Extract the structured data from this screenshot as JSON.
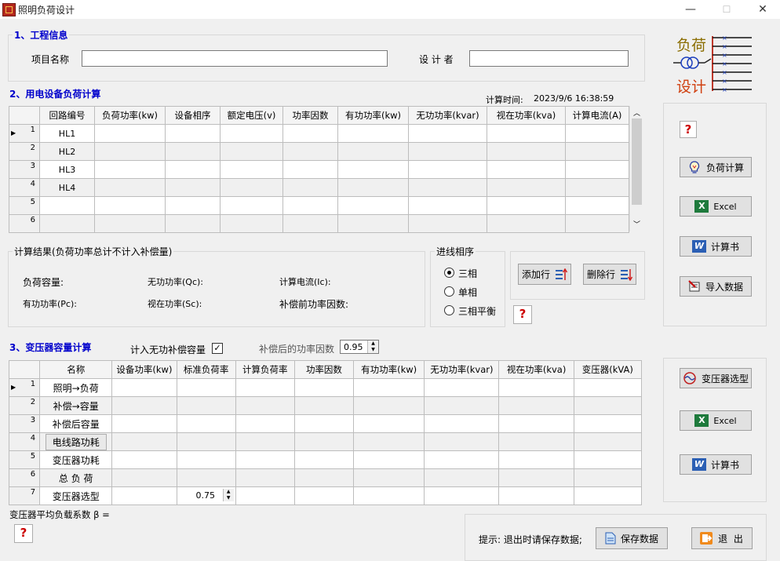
{
  "window": {
    "title": "照明负荷设计",
    "minimize": "—",
    "maximize": "☐",
    "close": "✕"
  },
  "project": {
    "section_title": "1、工程信息",
    "name_label": "项目名称",
    "name_value": "",
    "designer_label": "设 计 者",
    "designer_value": ""
  },
  "logo": {
    "top_text": "负荷",
    "bottom_text": "设计"
  },
  "load": {
    "section_title": "2、用电设备负荷计算",
    "calc_time_label": "计算时间:",
    "calc_time_value": "2023/9/6 16:38:59",
    "columns": [
      "回路编号",
      "负荷功率(kw)",
      "设备相序",
      "额定电压(v)",
      "功率因数",
      "有功功率(kw)",
      "无功功率(kvar)",
      "视在功率(kva)",
      "计算电流(A)"
    ],
    "rows": [
      {
        "num": "1",
        "cells": [
          "HL1",
          "",
          "",
          "",
          "",
          "",
          "",
          "",
          ""
        ]
      },
      {
        "num": "2",
        "cells": [
          "HL2",
          "",
          "",
          "",
          "",
          "",
          "",
          "",
          ""
        ]
      },
      {
        "num": "3",
        "cells": [
          "HL3",
          "",
          "",
          "",
          "",
          "",
          "",
          "",
          ""
        ]
      },
      {
        "num": "4",
        "cells": [
          "HL4",
          "",
          "",
          "",
          "",
          "",
          "",
          "",
          ""
        ]
      },
      {
        "num": "5",
        "cells": [
          "",
          "",
          "",
          "",
          "",
          "",
          "",
          "",
          ""
        ]
      },
      {
        "num": "6",
        "cells": [
          "",
          "",
          "",
          "",
          "",
          "",
          "",
          "",
          ""
        ]
      }
    ]
  },
  "result": {
    "title": "计算结果(负荷功率总计不计入补偿量)",
    "load_capacity": "负荷容量:",
    "reactive_power": "无功功率(Qc):",
    "calc_current": "计算电流(Ic):",
    "active_power": "有功功率(Pc):",
    "apparent_power": "视在功率(Sc):",
    "pf_before": "补偿前功率因数:"
  },
  "phase": {
    "title": "进线相序",
    "options": [
      "三相",
      "单相",
      "三相平衡"
    ],
    "selected": "三相"
  },
  "row_buttons": {
    "add": "添加行",
    "delete": "删除行"
  },
  "side_buttons": {
    "help": "?",
    "load_calc": "负荷计算",
    "excel": "Excel",
    "report": "计算书",
    "import": "导入数据"
  },
  "transformer": {
    "section_title": "3、变压器容量计算",
    "include_comp_label": "计入无功补偿容量",
    "include_comp_checked": true,
    "pf_after_label": "补偿后的功率因数",
    "pf_after_value": "0.95",
    "columns": [
      "名称",
      "设备功率(kw)",
      "标准负荷率",
      "计算负荷率",
      "功率因数",
      "有功功率(kw)",
      "无功功率(kvar)",
      "视在功率(kva)",
      "变压器(kVA)"
    ],
    "rows": [
      {
        "num": "1",
        "name": "照明→负荷"
      },
      {
        "num": "2",
        "name": "补偿→容量"
      },
      {
        "num": "3",
        "name": "补偿后容量"
      },
      {
        "num": "4",
        "name": "电线路功耗"
      },
      {
        "num": "5",
        "name": "变压器功耗"
      },
      {
        "num": "6",
        "name": "总 负 荷"
      },
      {
        "num": "7",
        "name": "变压器选型"
      }
    ],
    "std_load_rate": "0.75",
    "avg_load_label": "变压器平均负载系数 β ="
  },
  "transformer_buttons": {
    "select": "变压器选型",
    "excel": "Excel",
    "report": "计算书"
  },
  "footer": {
    "hint": "提示: 退出时请保存数据;",
    "save": "保存数据",
    "exit": "退 出"
  }
}
